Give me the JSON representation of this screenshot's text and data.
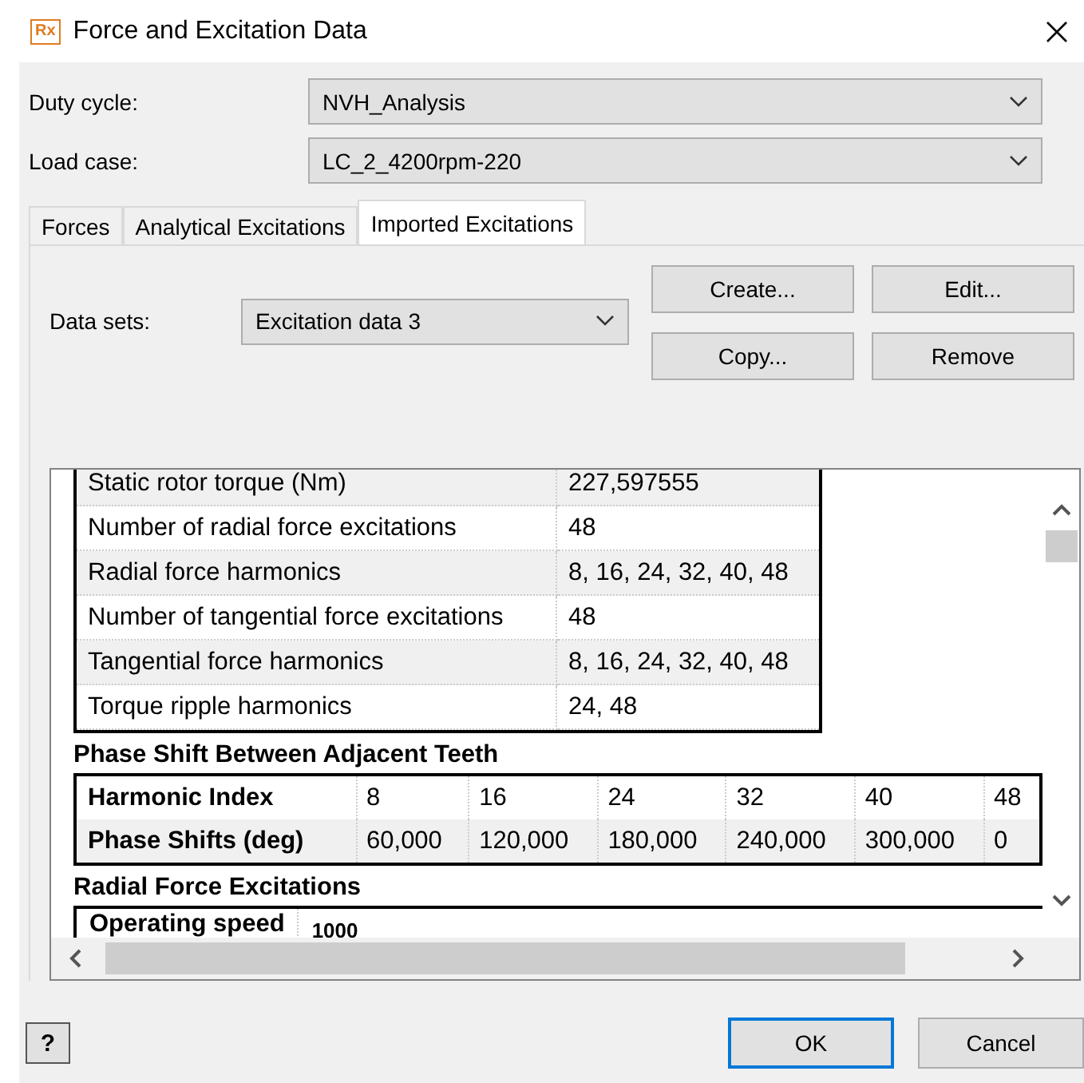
{
  "window": {
    "title": "Force and Excitation Data",
    "logo": "Rx"
  },
  "fields": [
    {
      "label": "Duty cycle:",
      "value": "NVH_Analysis"
    },
    {
      "label": "Load case:",
      "value": "LC_2_4200rpm-220"
    }
  ],
  "tabs": [
    {
      "label": "Forces",
      "selected": false
    },
    {
      "label": "Analytical Excitations",
      "selected": false
    },
    {
      "label": "Imported Excitations",
      "selected": true
    }
  ],
  "data_sets": {
    "label": "Data sets:",
    "value": "Excitation data 3"
  },
  "actions": [
    "Create...",
    "Edit...",
    "Copy...",
    "Remove"
  ],
  "properties": [
    {
      "name": "Static rotor torque (Nm)",
      "value": "227,597555"
    },
    {
      "name": "Number of radial force excitations",
      "value": "48"
    },
    {
      "name": "Radial force harmonics",
      "value": "8, 16, 24, 32, 40, 48"
    },
    {
      "name": "Number of tangential force excitations",
      "value": "48"
    },
    {
      "name": "Tangential force harmonics",
      "value": "8, 16, 24, 32, 40, 48"
    },
    {
      "name": "Torque ripple harmonics",
      "value": "24, 48"
    }
  ],
  "phase_shift": {
    "title": "Phase Shift Between Adjacent Teeth",
    "rows": [
      {
        "header": "Harmonic Index",
        "cells": [
          "8",
          "16",
          "24",
          "32",
          "40",
          "48"
        ]
      },
      {
        "header": "Phase Shifts (deg)",
        "cells": [
          "60,000",
          "120,000",
          "180,000",
          "240,000",
          "300,000",
          "0"
        ]
      }
    ]
  },
  "radial": {
    "title": "Radial Force Excitations",
    "header": "Operating speed",
    "value": "1000"
  },
  "help": "?",
  "buttons": [
    {
      "label": "OK",
      "default": true
    },
    {
      "label": "Cancel",
      "default": false
    }
  ]
}
